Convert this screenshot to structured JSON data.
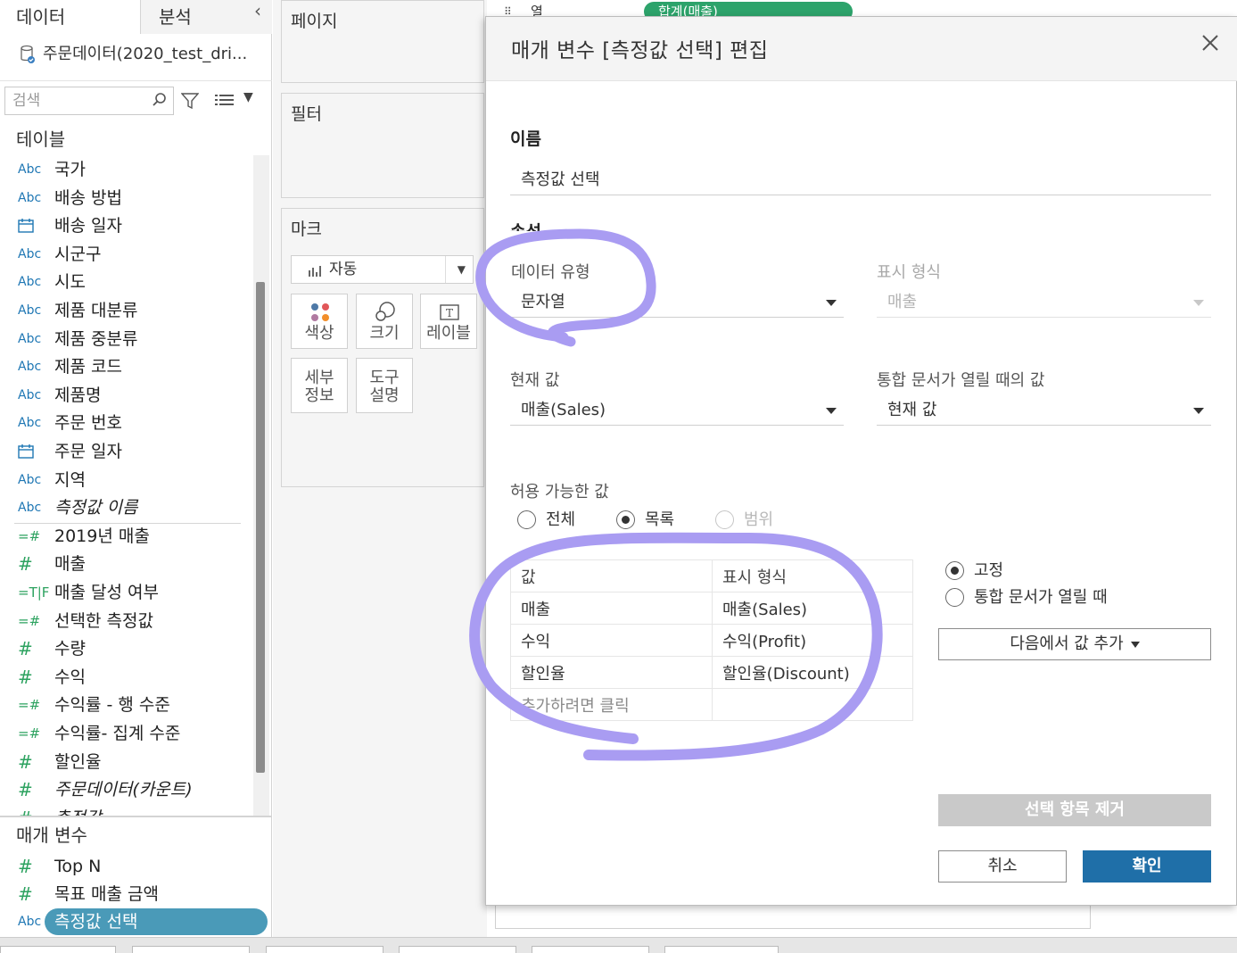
{
  "left_pane": {
    "tab_data": "데이터",
    "tab_analysis": "분석",
    "datasource": "주문데이터(2020_test_dri...",
    "search_placeholder": "검색",
    "tables_title": "테이블",
    "fields": [
      {
        "type": "Abc",
        "name": "국가",
        "italic": false
      },
      {
        "type": "Abc",
        "name": "배송 방법",
        "italic": false
      },
      {
        "type": "date",
        "name": "배송 일자",
        "italic": false
      },
      {
        "type": "Abc",
        "name": "시군구",
        "italic": false
      },
      {
        "type": "Abc",
        "name": "시도",
        "italic": false
      },
      {
        "type": "Abc",
        "name": "제품 대분류",
        "italic": false
      },
      {
        "type": "Abc",
        "name": "제품 중분류",
        "italic": false
      },
      {
        "type": "Abc",
        "name": "제품 코드",
        "italic": false
      },
      {
        "type": "Abc",
        "name": "제품명",
        "italic": false
      },
      {
        "type": "Abc",
        "name": "주문 번호",
        "italic": false
      },
      {
        "type": "date",
        "name": "주문 일자",
        "italic": false
      },
      {
        "type": "Abc",
        "name": "지역",
        "italic": false
      },
      {
        "type": "Abc",
        "name": "측정값 이름",
        "italic": true
      },
      {
        "type": "=#",
        "name": "2019년 매출",
        "italic": false
      },
      {
        "type": "#",
        "name": "매출",
        "italic": false
      },
      {
        "type": "=T|F",
        "name": "매출 달성 여부",
        "italic": false
      },
      {
        "type": "=#",
        "name": "선택한 측정값",
        "italic": false
      },
      {
        "type": "#",
        "name": "수량",
        "italic": false
      },
      {
        "type": "#",
        "name": "수익",
        "italic": false
      },
      {
        "type": "=#",
        "name": "수익률 - 행 수준",
        "italic": false
      },
      {
        "type": "=#",
        "name": "수익률- 집계 수준",
        "italic": false
      },
      {
        "type": "#",
        "name": "할인율",
        "italic": false
      },
      {
        "type": "#",
        "name": "주문데이터(카운트)",
        "italic": true
      },
      {
        "type": "#",
        "name": "측정값",
        "italic": true
      }
    ],
    "params_title": "매개 변수",
    "params": [
      {
        "type": "#",
        "name": "Top N"
      },
      {
        "type": "#",
        "name": "목표 매출 금액"
      },
      {
        "type": "Abc",
        "name": "측정값 선택"
      }
    ]
  },
  "shelves": {
    "pages": "페이지",
    "filters": "필터",
    "marks": "마크",
    "mark_type": "자동",
    "mark_buttons": [
      "색상",
      "크기",
      "레이블",
      "세부\n정보",
      "도구\n설명"
    ]
  },
  "columns_shelf": {
    "label": "열",
    "pill": "합계(매출)"
  },
  "dialog": {
    "title": "매개 변수 [측정값 선택] 편집",
    "name_label": "이름",
    "name_value": "측정값 선택",
    "properties_label": "속성",
    "data_type_label": "데이터 유형",
    "data_type_value": "문자열",
    "display_format_label": "표시 형식",
    "display_format_value": "매출",
    "current_value_label": "현재 값",
    "current_value": "매출(Sales)",
    "open_value_label": "통합 문서가 열릴 때의 값",
    "open_value": "현재 값",
    "allowable_label": "허용 가능한 값",
    "radio_all": "전체",
    "radio_list": "목록",
    "radio_range": "범위",
    "table_headers": [
      "값",
      "표시 형식"
    ],
    "table_rows": [
      [
        "매출",
        "매출(Sales)"
      ],
      [
        "수익",
        "수익(Profit)"
      ],
      [
        "할인율",
        "할인율(Discount)"
      ]
    ],
    "add_row_hint": "추가하려면 클릭",
    "radio_fixed": "고정",
    "radio_on_open": "통합 문서가 열릴 때",
    "add_from_button": "다음에서 값 추가",
    "remove_button": "선택 항목 제거",
    "cancel_button": "취소",
    "ok_button": "확인"
  },
  "colors": {
    "accent_blue": "#1f6fa8",
    "selected_param": "#4a9ab8",
    "measure_green": "#2ca25f",
    "dimension_blue": "#1f77b4",
    "annotation_lavender": "#a99cf2"
  }
}
